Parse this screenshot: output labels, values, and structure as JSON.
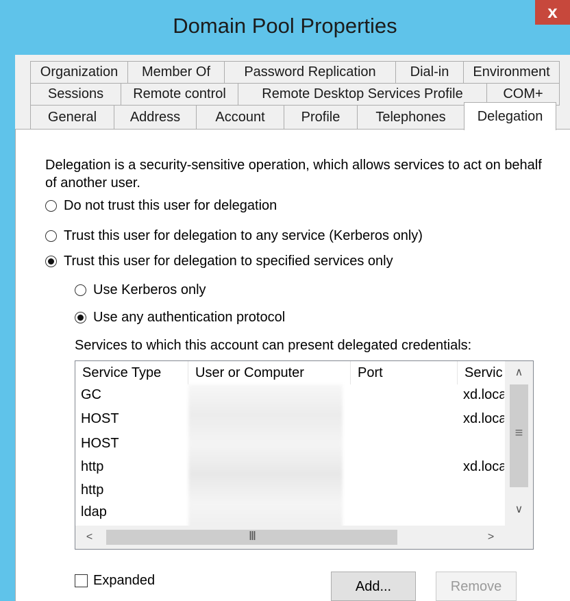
{
  "window": {
    "title": "Domain Pool Properties",
    "close_label": "x"
  },
  "tabs": {
    "row1": [
      "Organization",
      "Member Of",
      "Password Replication",
      "Dial-in",
      "Environment"
    ],
    "row2": [
      "Sessions",
      "Remote control",
      "Remote Desktop Services Profile",
      "COM+"
    ],
    "row3": [
      "General",
      "Address",
      "Account",
      "Profile",
      "Telephones",
      "Delegation"
    ],
    "active": "Delegation"
  },
  "delegation": {
    "description": "Delegation is a security-sensitive operation, which allows services to act on behalf of another user.",
    "options": [
      {
        "label": "Do not trust this user for delegation",
        "checked": false
      },
      {
        "label": "Trust this user for delegation to any service (Kerberos only)",
        "checked": false
      },
      {
        "label": "Trust this user for delegation to specified services only",
        "checked": true
      }
    ],
    "sub_options": [
      {
        "label": "Use Kerberos only",
        "checked": false
      },
      {
        "label": "Use any authentication protocol",
        "checked": true
      }
    ],
    "services_label": "Services to which this account can present delegated credentials:",
    "columns": [
      "Service Type",
      "User or Computer",
      "Port",
      "Servic"
    ],
    "rows": [
      {
        "service_type": "GC",
        "service_name": "xd.loca"
      },
      {
        "service_type": "HOST",
        "service_name": "xd.loca"
      },
      {
        "service_type": "HOST",
        "service_name": ""
      },
      {
        "service_type": "http",
        "service_name": "xd.loca"
      },
      {
        "service_type": "http",
        "service_name": ""
      },
      {
        "service_type": "ldap",
        "service_name": ""
      }
    ],
    "scroll_glyphs": {
      "up": "∧",
      "down": "∨",
      "left": "<",
      "right": ">",
      "grip_v": "≡",
      "grip_h": "III"
    },
    "expanded_label": "Expanded",
    "expanded_checked": false,
    "add_label": "Add...",
    "remove_label": "Remove"
  }
}
